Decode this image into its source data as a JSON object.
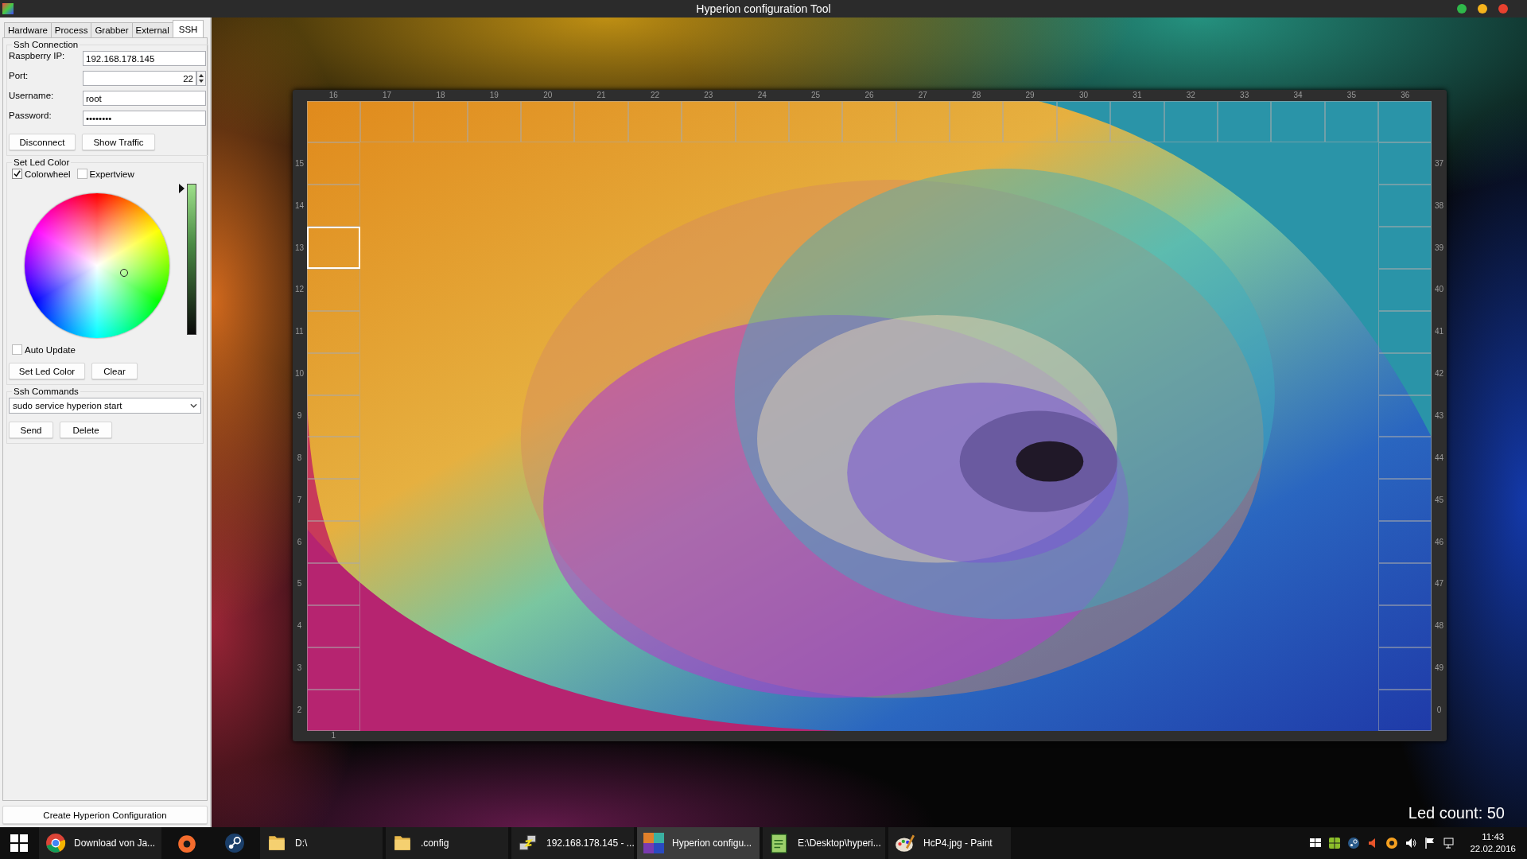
{
  "window": {
    "title": "Hyperion configuration Tool"
  },
  "tabs": [
    {
      "label": "Hardware",
      "selected": false
    },
    {
      "label": "Process",
      "selected": false
    },
    {
      "label": "Grabber",
      "selected": false
    },
    {
      "label": "External",
      "selected": false
    },
    {
      "label": "SSH",
      "selected": true
    }
  ],
  "ssh_connection": {
    "title": "Ssh Connection",
    "fields": [
      {
        "label": "Raspberry IP:",
        "value": "192.168.178.145",
        "kind": "text"
      },
      {
        "label": "Port:",
        "value": "22",
        "kind": "spin"
      },
      {
        "label": "Username:",
        "value": "root",
        "kind": "text"
      },
      {
        "label": "Password:",
        "value": "••••••••",
        "kind": "text"
      }
    ],
    "buttons": [
      "Disconnect",
      "Show Traffic"
    ]
  },
  "set_led_color": {
    "title": "Set Led Color",
    "options": [
      {
        "label": "Colorwheel",
        "checked": true
      },
      {
        "label": "Expertview",
        "checked": false
      }
    ],
    "brightness": {
      "level": 1
    },
    "auto_update": {
      "label": "Auto Update",
      "checked": false
    },
    "buttons": [
      "Set Led Color",
      "Clear"
    ]
  },
  "ssh_commands": {
    "title": "Ssh Commands",
    "command": "sudo service hyperion start",
    "buttons": [
      "Send",
      "Delete"
    ]
  },
  "create_button": "Create Hyperion Configuration",
  "leds": {
    "top": [
      {
        "label": "16",
        "selected": false
      },
      {
        "label": "17",
        "selected": false
      },
      {
        "label": "18",
        "selected": false
      },
      {
        "label": "19",
        "selected": false
      },
      {
        "label": "20",
        "selected": false
      },
      {
        "label": "21",
        "selected": false
      },
      {
        "label": "22",
        "selected": false
      },
      {
        "label": "23",
        "selected": false
      },
      {
        "label": "24",
        "selected": false
      },
      {
        "label": "25",
        "selected": false
      },
      {
        "label": "26",
        "selected": false
      },
      {
        "label": "27",
        "selected": false
      },
      {
        "label": "28",
        "selected": false
      },
      {
        "label": "29",
        "selected": false
      },
      {
        "label": "30",
        "selected": false
      },
      {
        "label": "31",
        "selected": false
      },
      {
        "label": "32",
        "selected": false
      },
      {
        "label": "33",
        "selected": false
      },
      {
        "label": "34",
        "selected": false
      },
      {
        "label": "35",
        "selected": false
      },
      {
        "label": "36",
        "selected": false
      }
    ],
    "left": [
      {
        "label": "15",
        "selected": false
      },
      {
        "label": "14",
        "selected": false
      },
      {
        "label": "13",
        "selected": true
      },
      {
        "label": "12",
        "selected": false
      },
      {
        "label": "11",
        "selected": false
      },
      {
        "label": "10",
        "selected": false
      },
      {
        "label": "9",
        "selected": false
      },
      {
        "label": "8",
        "selected": false
      },
      {
        "label": "7",
        "selected": false
      },
      {
        "label": "6",
        "selected": false
      },
      {
        "label": "5",
        "selected": false
      },
      {
        "label": "4",
        "selected": false
      },
      {
        "label": "3",
        "selected": false
      },
      {
        "label": "2",
        "selected": false
      }
    ],
    "right": [
      {
        "label": "37",
        "selected": false
      },
      {
        "label": "38",
        "selected": false
      },
      {
        "label": "39",
        "selected": false
      },
      {
        "label": "40",
        "selected": false
      },
      {
        "label": "41",
        "selected": false
      },
      {
        "label": "42",
        "selected": false
      },
      {
        "label": "43",
        "selected": false
      },
      {
        "label": "44",
        "selected": false
      },
      {
        "label": "45",
        "selected": false
      },
      {
        "label": "46",
        "selected": false
      },
      {
        "label": "47",
        "selected": false
      },
      {
        "label": "48",
        "selected": false
      },
      {
        "label": "49",
        "selected": false
      },
      {
        "label": "0",
        "selected": false
      }
    ],
    "bottom": [
      {
        "label": "1"
      }
    ]
  },
  "led_count": "Led count: 50",
  "taskbar": {
    "items": [
      {
        "kind": "chrome",
        "label": "Download von Ja...",
        "selected": false
      },
      {
        "kind": "origin",
        "selected": false
      },
      {
        "kind": "steam",
        "selected": false
      },
      {
        "kind": "folder",
        "label": "D:\\",
        "selected": false
      },
      {
        "kind": "folder",
        "label": ".config",
        "selected": false
      },
      {
        "kind": "putty",
        "label": "192.168.178.145 - ...",
        "selected": false
      },
      {
        "kind": "hyperion",
        "label": "Hyperion configu...",
        "selected": true
      },
      {
        "kind": "notepad",
        "label": "E:\\Desktop\\hyperi...",
        "selected": false
      },
      {
        "kind": "paint",
        "label": "HcP4.jpg - Paint",
        "selected": false
      }
    ],
    "time": "11:43",
    "date": "22.02.2016"
  }
}
